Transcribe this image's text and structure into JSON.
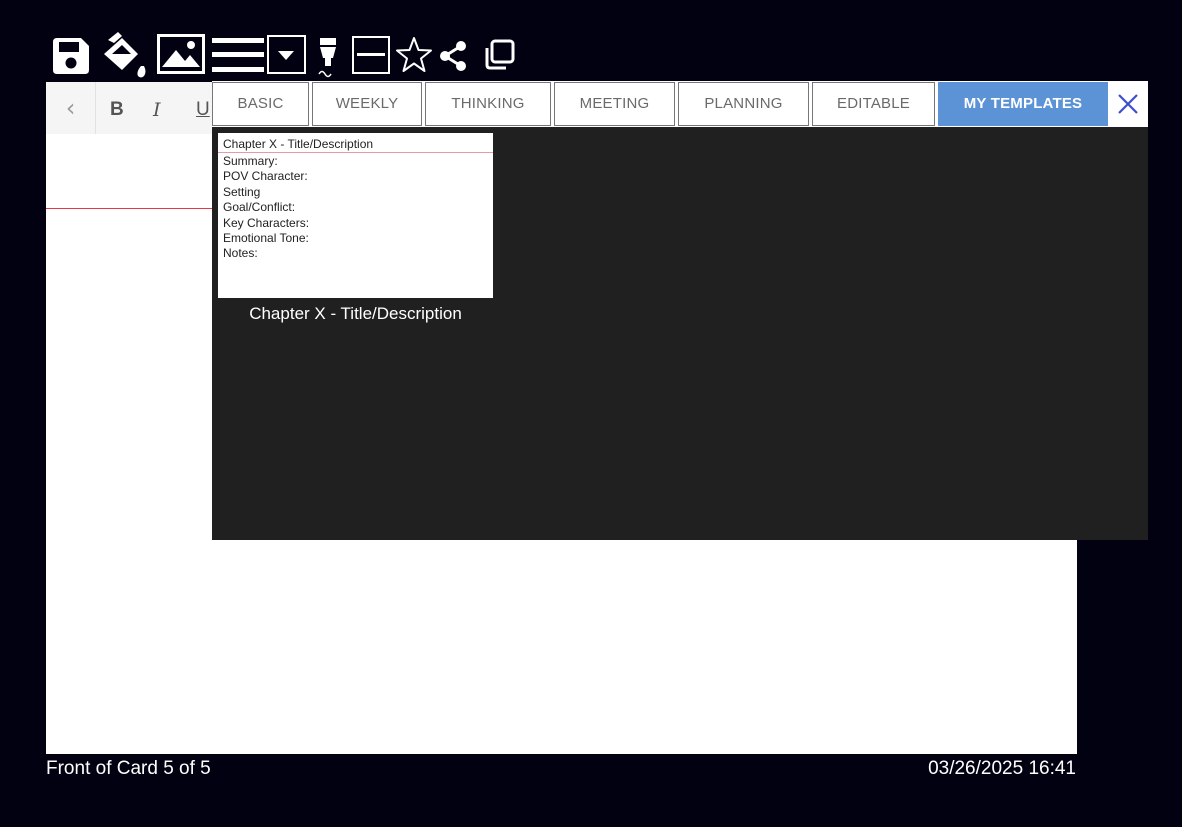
{
  "toolbar": {
    "icons": [
      "save-icon",
      "fill-color-icon",
      "image-icon",
      "line-spacing-icon",
      "dropdown-arrow-icon",
      "highlighter-icon",
      "horizontal-rule-icon",
      "star-icon",
      "share-icon",
      "copy-icon"
    ]
  },
  "format_bar": {
    "back_glyph": "‹",
    "bold": "B",
    "italic": "I",
    "underline": "U"
  },
  "template_panel": {
    "tabs": [
      {
        "label": "BASIC",
        "active": false
      },
      {
        "label": "WEEKLY",
        "active": false
      },
      {
        "label": "THINKING",
        "active": false
      },
      {
        "label": "MEETING",
        "active": false
      },
      {
        "label": "PLANNING",
        "active": false
      },
      {
        "label": "EDITABLE",
        "active": false
      },
      {
        "label": "MY TEMPLATES",
        "active": true
      }
    ],
    "active_tab_color": "#5b93d6",
    "close_icon": "close-icon",
    "templates": [
      {
        "caption": "Chapter X - Title/Description",
        "thumb_title": "Chapter X - Title/Description",
        "thumb_lines": [
          "Summary:",
          "POV Character:",
          "Setting",
          "Goal/Conflict:",
          "Key Characters:",
          "Emotional Tone:",
          "Notes:"
        ]
      }
    ]
  },
  "footer": {
    "card_position": "Front of Card 5 of 5",
    "timestamp": "03/26/2025 16:41"
  }
}
